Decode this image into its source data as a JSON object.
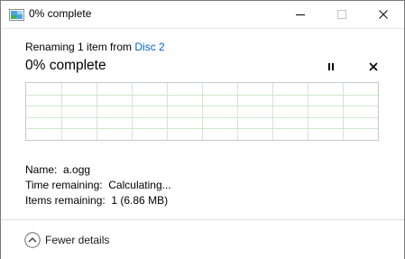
{
  "window": {
    "title": "0% complete"
  },
  "dialog": {
    "renaming_prefix": "Renaming 1 item from ",
    "source_link": "Disc 2",
    "percent_text": "0% complete",
    "progress_fraction": 0
  },
  "details": {
    "name_label": "Name:",
    "name_value": "a.ogg",
    "time_label": "Time remaining:",
    "time_value": "Calculating...",
    "items_label": "Items remaining:",
    "items_value": "1 (6.86 MB)"
  },
  "footer": {
    "fewer_details_label": "Fewer details"
  },
  "colors": {
    "grid_line": "#cde8cd",
    "link": "#0066cc"
  }
}
